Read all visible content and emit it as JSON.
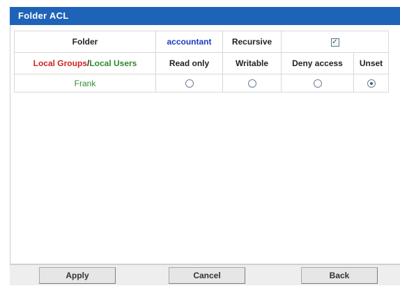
{
  "title": "Folder ACL",
  "header": {
    "folder_label": "Folder",
    "folder_name": "accountant",
    "recursive_label": "Recursive",
    "recursive_checked": true
  },
  "columns": {
    "groups_label": "Local Groups",
    "separator": "/",
    "users_label": "Local Users",
    "read_only": "Read only",
    "writable": "Writable",
    "deny_access": "Deny access",
    "unset": "Unset"
  },
  "users": [
    {
      "name": "Frank",
      "permission": "Unset"
    }
  ],
  "buttons": {
    "apply": "Apply",
    "cancel": "Cancel",
    "back": "Back"
  },
  "colors": {
    "title_bar": "#1f63b8",
    "folder_name": "#1a3dbf",
    "groups_label": "#d22222",
    "users_label": "#2e8b2e"
  }
}
